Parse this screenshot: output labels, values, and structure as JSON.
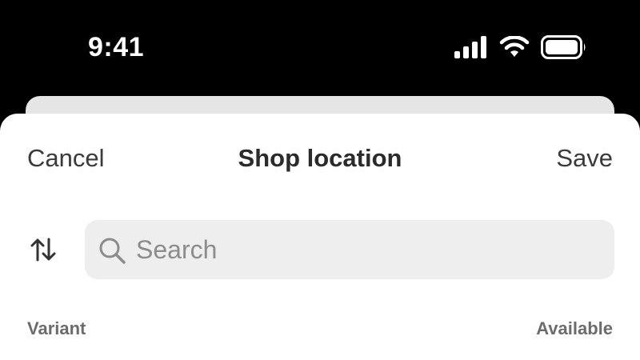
{
  "status_bar": {
    "time": "9:41",
    "icons": [
      "signal-icon",
      "wifi-icon",
      "battery-icon"
    ]
  },
  "nav": {
    "cancel_label": "Cancel",
    "title": "Shop location",
    "save_label": "Save"
  },
  "search": {
    "placeholder": "Search",
    "value": ""
  },
  "sort_icon": "sort-arrows-icon",
  "table": {
    "columns": [
      "Variant",
      "Available"
    ]
  },
  "colors": {
    "status_background": "#000000",
    "sheet_background": "#ffffff",
    "search_background": "#eeeeee",
    "back_card": "#e5e5e5"
  }
}
